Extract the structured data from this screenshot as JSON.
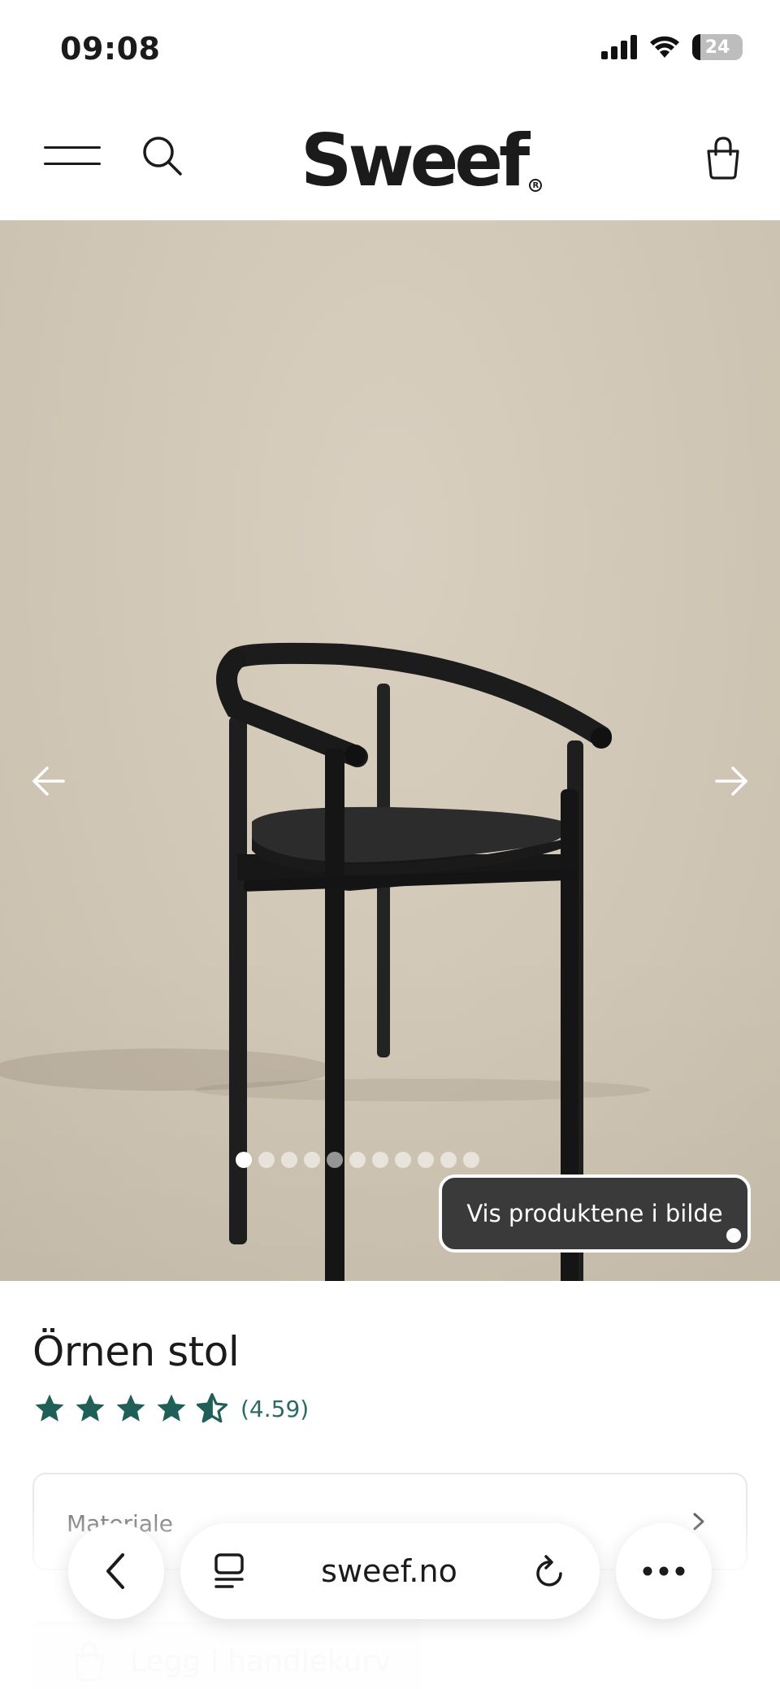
{
  "status_bar": {
    "time": "09:08",
    "battery_level": "24"
  },
  "header": {
    "logo": "Sweef",
    "logo_mark": "R",
    "icons": [
      "menu-icon",
      "search-icon",
      "shopping-bag-icon"
    ]
  },
  "gallery": {
    "image_count": 11,
    "active_index": 0,
    "show_products_label": "Vis produktene i bilde",
    "icons": [
      "arrow-left-icon",
      "arrow-right-icon"
    ]
  },
  "product": {
    "title": "Örnen stol",
    "rating_value": 4.59,
    "rating_text": "(4.59)",
    "rating_max": 5,
    "star_color": "#1f5f57"
  },
  "options": {
    "material_label": "Materiale"
  },
  "actions": {
    "add_to_cart_label": "Legg i handlekurv"
  },
  "browser": {
    "url": "sweef.no",
    "icons": [
      "back-icon",
      "tabs-icon",
      "reload-icon",
      "more-icon"
    ]
  }
}
